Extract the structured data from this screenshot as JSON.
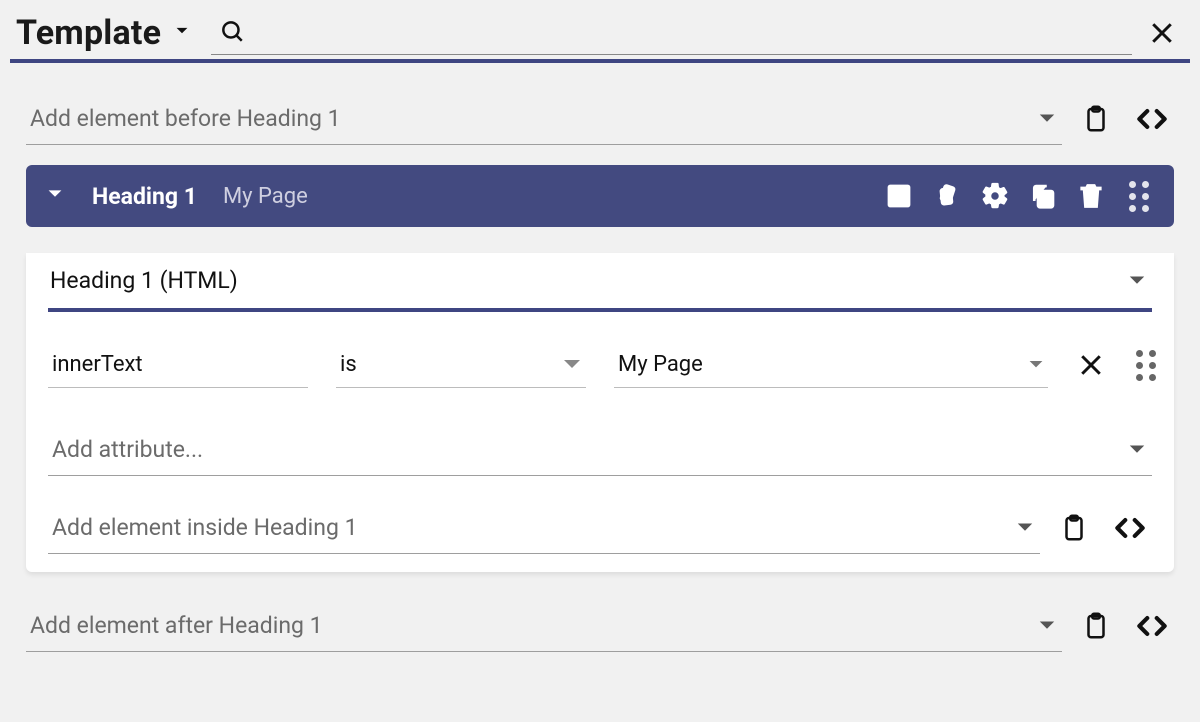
{
  "header": {
    "title": "Template"
  },
  "before": {
    "placeholder": "Add element before Heading 1"
  },
  "element": {
    "name": "Heading 1",
    "subtitle": "My Page",
    "type_label": "Heading 1 (HTML)",
    "prop": {
      "name": "innerText",
      "op": "is",
      "value": "My Page"
    },
    "add_attr_placeholder": "Add attribute...",
    "add_inside_placeholder": "Add element inside Heading 1"
  },
  "after": {
    "placeholder": "Add element after Heading 1"
  }
}
